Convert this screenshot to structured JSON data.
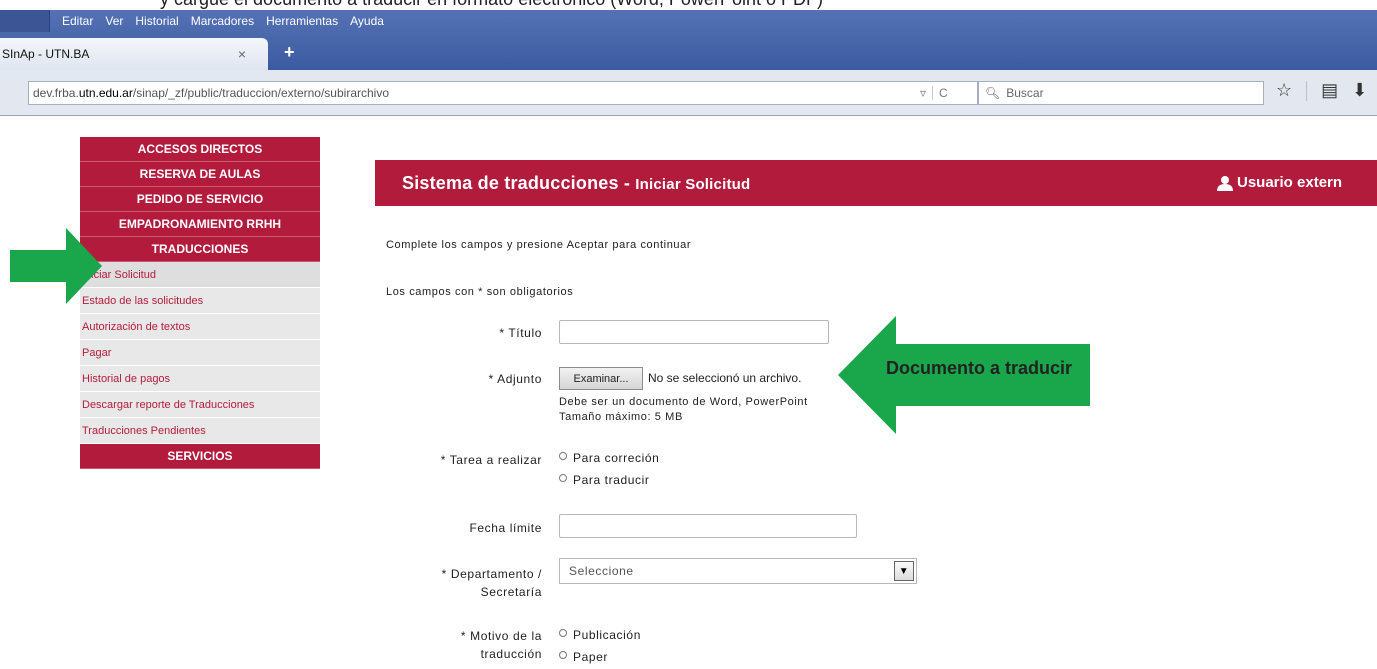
{
  "doc_caption": "y cargue el documento a traducir en formato electrónico (Word, PowerPoint o PDF)",
  "browser": {
    "menu": [
      "Editar",
      "Ver",
      "Historial",
      "Marcadores",
      "Herramientas",
      "Ayuda"
    ],
    "tab_title": "SInAp - UTN.BA",
    "tab_close": "×",
    "new_tab": "+",
    "url_prefix": "dev.frba.",
    "url_host": "utn.edu.ar",
    "url_path": "/sinap/_zf/public/traduccion/externo/subirarchivo",
    "search_placeholder": "Buscar"
  },
  "sidebar": {
    "top_items": [
      "ACCESOS DIRECTOS",
      "RESERVA DE AULAS",
      "PEDIDO DE SERVICIO",
      "EMPADRONAMIENTO RRHH",
      "TRADUCCIONES"
    ],
    "sub_items": [
      "Iniciar Solicitud",
      "Estado de las solicitudes",
      "Autorización de textos",
      "Pagar",
      "Historial de pagos",
      "Descargar reporte de Traducciones",
      "Traducciones Pendientes"
    ],
    "bottom_item": "SERVICIOS"
  },
  "panel": {
    "title_main": "Sistema de traducciones - ",
    "title_sub": "Iniciar Solicitud",
    "user": "Usuario extern"
  },
  "form": {
    "intro": "Complete los campos y presione Aceptar para continuar",
    "required_note": "Los campos con * son obligatorios",
    "titulo_label": "* Título",
    "adjunto_label": "* Adjunto",
    "browse_button": "Examinar...",
    "no_file": "No se seleccionó un archivo.",
    "hint_line1": "Debe ser un documento de Word, PowerPoint",
    "hint_line2": "Tamaño máximo: 5 MB",
    "tarea_label": "* Tarea a realizar",
    "tarea_options": [
      "Para correción",
      "Para traducir"
    ],
    "fecha_label": "Fecha límite",
    "depto_label_1": "* Departamento /",
    "depto_label_2": "Secretaría",
    "depto_selected": "Seleccione",
    "motivo_label_1": "* Motivo de la",
    "motivo_label_2": "traducción",
    "motivo_options": [
      "Publicación",
      "Paper"
    ]
  },
  "annotation": {
    "label": "Documento a traducir",
    "color": "#1aa64b"
  }
}
